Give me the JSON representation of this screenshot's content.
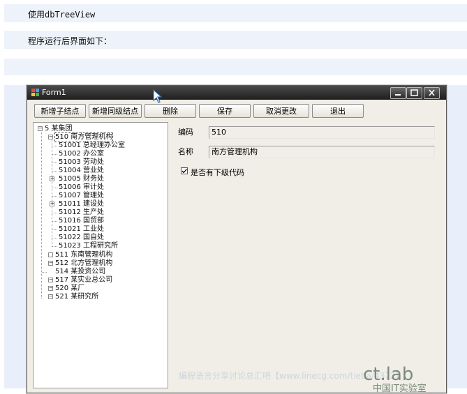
{
  "doc": {
    "line1_prefix": "使用",
    "line1_code": "dbTreeView",
    "line2": "程序运行后界面如下："
  },
  "window": {
    "title": "Form1",
    "controls": {
      "minimize": "minimize-icon",
      "maximize": "maximize-icon",
      "close": "close-icon"
    }
  },
  "toolbar": {
    "add_child": "新增子结点",
    "add_sibling": "新增同级结点",
    "delete": "删除",
    "save": "保存",
    "cancel": "取消更改",
    "exit": "退出"
  },
  "tree": {
    "root": "5 某集团",
    "level1_expanded": "510 南方管理机构",
    "children": [
      "51001 总经理办公室",
      "51002 办公室",
      "51003 劳动处",
      "51004 营业处",
      "51005 财务处",
      "51006 审计处",
      "51007 管理处",
      "51011 建设处",
      "51012 生产处",
      "51016 国贸部",
      "51021 工业处",
      "51022 国自处",
      "51023 工程研究所"
    ],
    "others": [
      "511 东南管理机构",
      "512 北方管理机构",
      "514 某投资公司",
      "517 某实业总公司",
      "520 某厂",
      "521 某研究所"
    ]
  },
  "form": {
    "code_label": "编码",
    "code_value": "510",
    "name_label": "名称",
    "name_value": "南方管理机构",
    "has_child_label": "是否有下级代码",
    "has_child_checked": true
  },
  "watermark": "编程语言分享讨论总汇吧【www.linecg.com/tieba/4372】",
  "logo": {
    "main": "ct.lab",
    "sub": "中国IT实验室"
  }
}
